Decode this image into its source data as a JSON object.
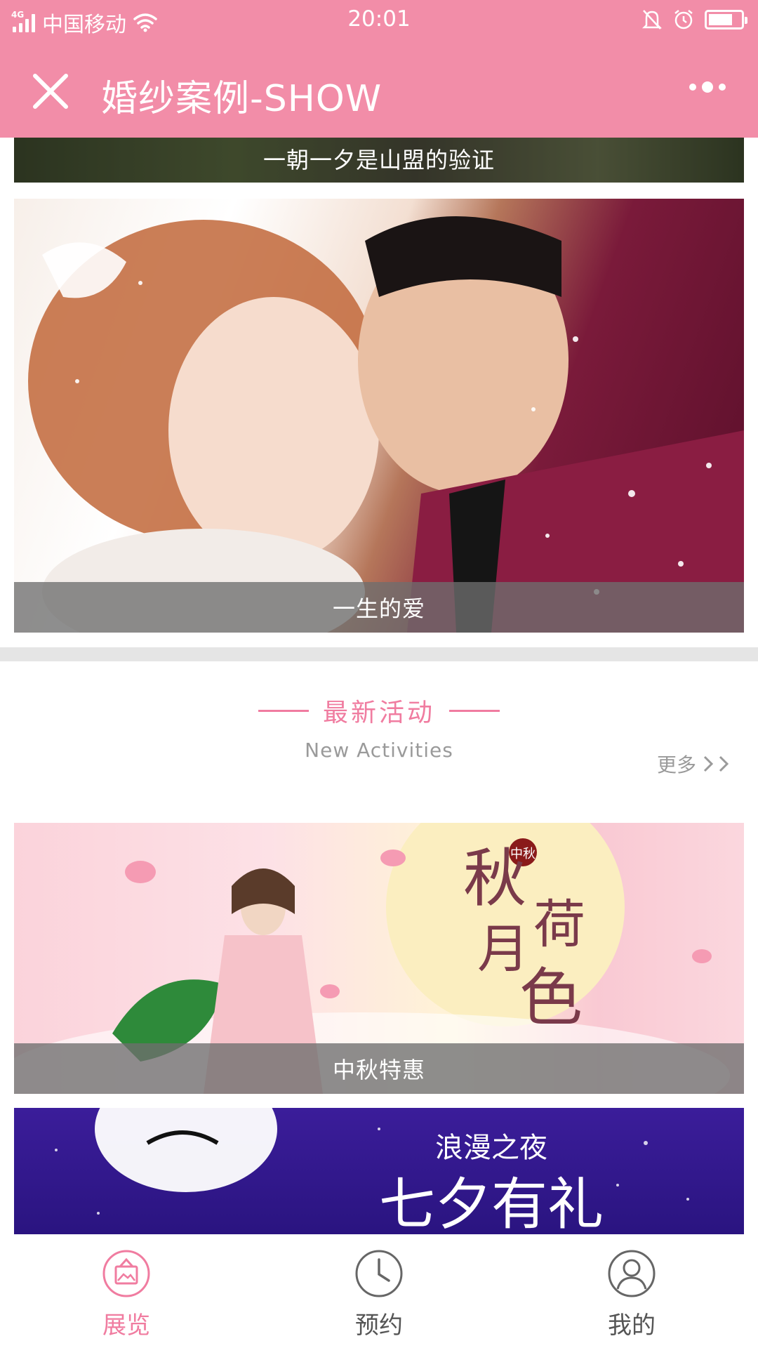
{
  "status_bar": {
    "network": "4G",
    "carrier": "中国移动",
    "time": "20:01",
    "battery_level": 0.75
  },
  "nav": {
    "title": "婚纱案例-SHOW"
  },
  "cases": [
    {
      "caption": "一朝一夕是山盟的验证"
    },
    {
      "caption": "一生的爱"
    }
  ],
  "activities_section": {
    "title": "最新活动",
    "subtitle": "New Activities",
    "more": "更多"
  },
  "activities": [
    {
      "caption": "中秋特惠",
      "overlay_text": [
        "中秋",
        "秋",
        "月",
        "荷",
        "色"
      ]
    },
    {
      "caption": "",
      "overlay_text": [
        "浪漫之夜",
        "七夕有礼"
      ]
    }
  ],
  "tab_bar": {
    "items": [
      {
        "label": "展览",
        "icon": "exhibition-icon",
        "active": true
      },
      {
        "label": "预约",
        "icon": "clock-icon",
        "active": false
      },
      {
        "label": "我的",
        "icon": "user-icon",
        "active": false
      }
    ]
  },
  "colors": {
    "brand_pink": "#f28da8",
    "accent_pink": "#f07ca0",
    "muted_gray": "#9a9a9a"
  }
}
